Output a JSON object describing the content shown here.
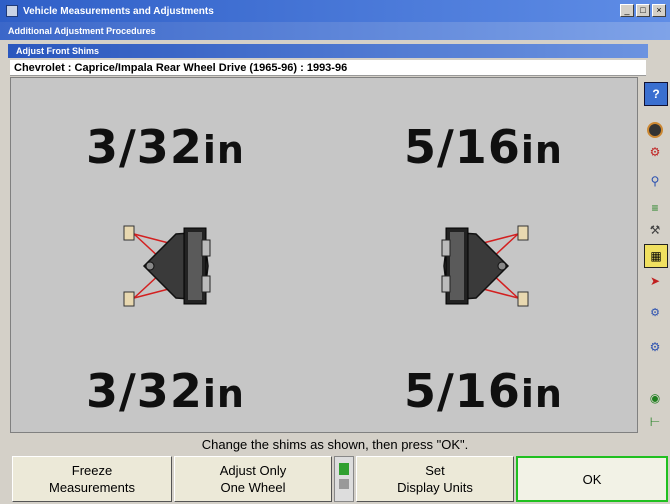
{
  "window": {
    "title": "Vehicle Measurements and Adjustments",
    "subtitle": "Additional Adjustment Procedures",
    "panel_title": "Adjust Front Shims",
    "controls": [
      "_",
      "□",
      "×"
    ]
  },
  "vehicle": "Chevrolet : Caprice/Impala Rear Wheel Drive (1965-96) : 1993-96",
  "measurements": {
    "left_top": {
      "value": "3/32",
      "unit": "in"
    },
    "right_top": {
      "value": "5/16",
      "unit": "in"
    },
    "left_bottom": {
      "value": "3/32",
      "unit": "in"
    },
    "right_bottom": {
      "value": "5/16",
      "unit": "in"
    }
  },
  "toolbar_icons": [
    "help-icon",
    "target-icon",
    "steering-icon",
    "lift-icon",
    "axle-icon",
    "adjust-icon",
    "arrow-icon",
    "tools-icon",
    "settings-icon",
    "wheel-icon",
    "shim-icon"
  ],
  "status": "Change the shims as shown, then press \"OK\".",
  "buttons": {
    "freeze": [
      "Freeze",
      "Measurements"
    ],
    "adjust_one": [
      "Adjust Only",
      "One Wheel"
    ],
    "set_units": [
      "Set",
      "Display Units"
    ],
    "ok": "OK"
  },
  "colors": {
    "titlebar": "#2f5fc7",
    "shim_line": "#d32020",
    "ok_border": "#20c020"
  }
}
